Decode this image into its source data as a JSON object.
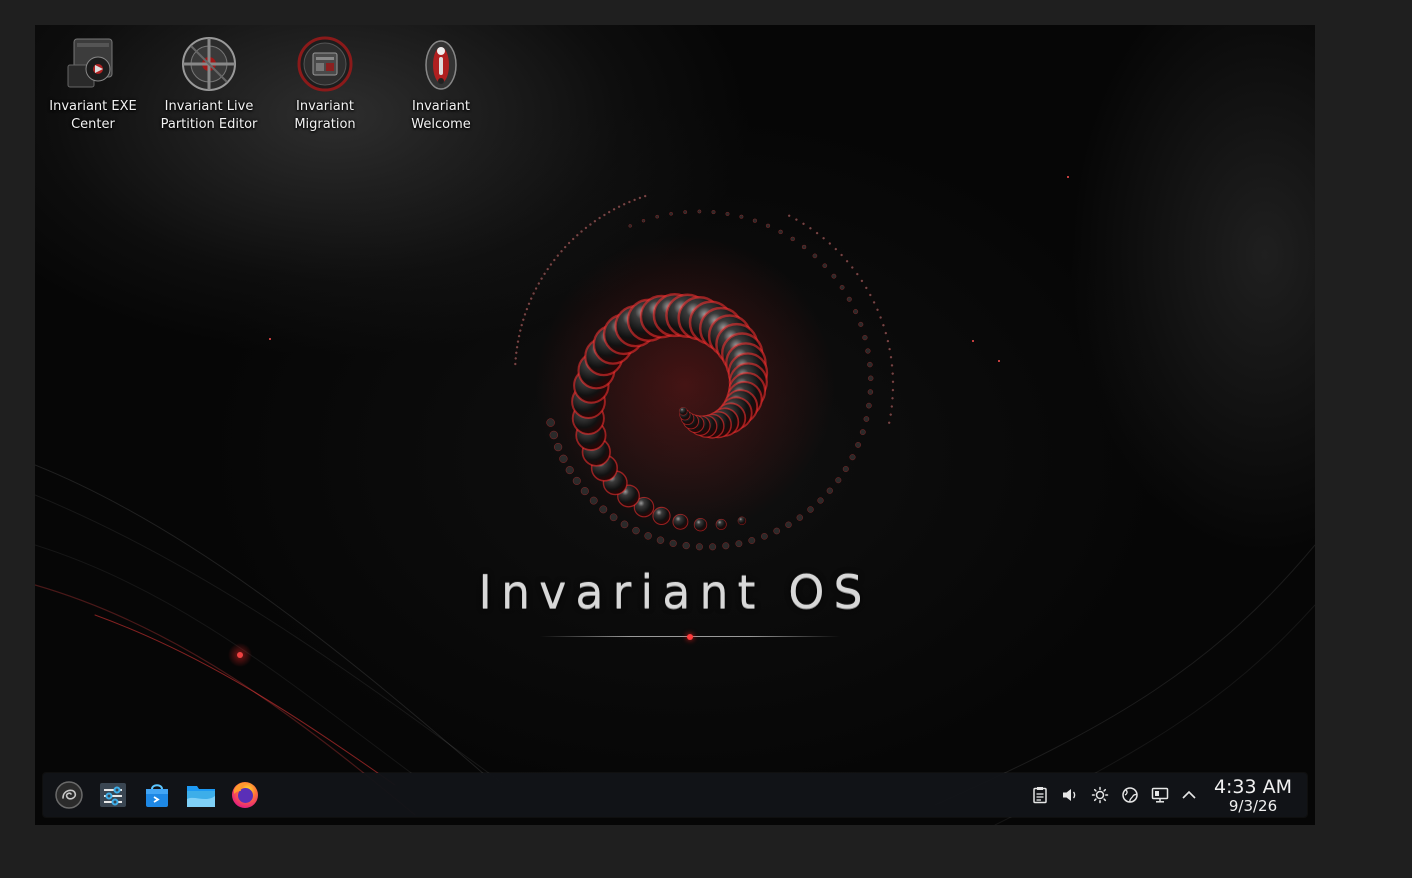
{
  "desktop": {
    "icons": [
      {
        "label": "Invariant EXE\nCenter",
        "icon": "exe-center-icon"
      },
      {
        "label": "Invariant Live\nPartition Editor",
        "icon": "partition-editor-icon"
      },
      {
        "label": "Invariant\nMigration",
        "icon": "migration-icon"
      },
      {
        "label": "Invariant\nWelcome",
        "icon": "welcome-icon"
      }
    ],
    "wallpaper": {
      "title": "Invariant OS",
      "accent": "#ff3030",
      "bead_color": "#1a1a1a"
    }
  },
  "taskbar": {
    "launchers": [
      {
        "icon": "app-launcher-icon"
      },
      {
        "icon": "system-settings-icon"
      },
      {
        "icon": "software-store-icon"
      },
      {
        "icon": "file-manager-icon"
      },
      {
        "icon": "firefox-icon"
      }
    ],
    "tray": [
      {
        "icon": "clipboard-icon"
      },
      {
        "icon": "volume-icon"
      },
      {
        "icon": "brightness-icon"
      },
      {
        "icon": "network-globe-icon"
      },
      {
        "icon": "display-icon"
      },
      {
        "icon": "chevron-up-icon"
      }
    ],
    "clock": {
      "time": "4:33 AM",
      "date": "9/3/26"
    }
  }
}
